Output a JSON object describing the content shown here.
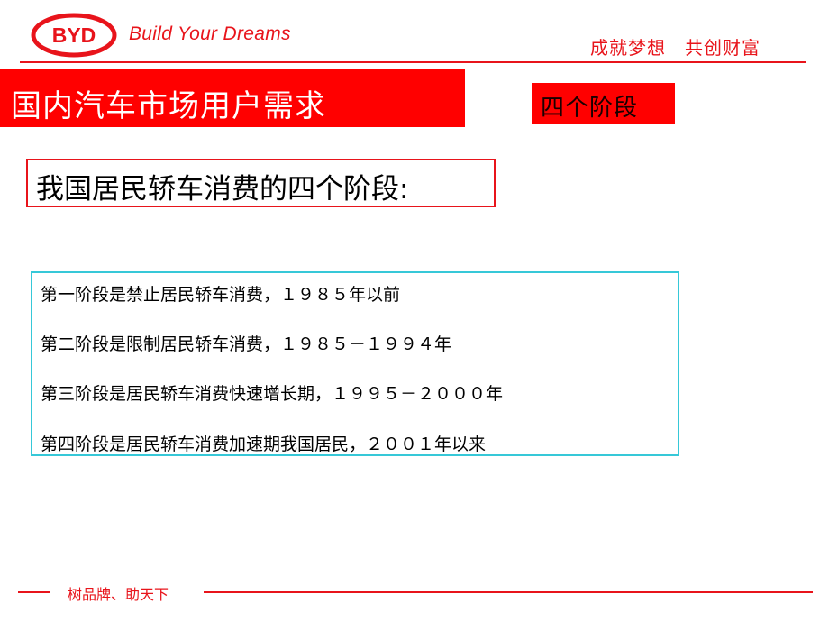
{
  "header": {
    "logo_text": "BYD",
    "slogan_en": "Build Your Dreams",
    "slogan_cn": "成就梦想　共创财富"
  },
  "title": {
    "text": "国内汽车市场用户需求",
    "badge": "四个阶段"
  },
  "subtitle": "我国居民轿车消费的四个阶段:",
  "stages": [
    "第一阶段是禁止居民轿车消费，１９８５年以前",
    "第二阶段是限制居民轿车消费，１９８５－１９９４年",
    "第三阶段是居民轿车消费快速增长期，１９９５－２０００年",
    "第四阶段是居民轿车消费加速期我国居民，２００１年以来"
  ],
  "footer": {
    "text": "树品牌、助天下"
  },
  "colors": {
    "brand_red": "#e8141b",
    "title_red": "#ff0000",
    "box_cyan": "#36c8d8"
  }
}
